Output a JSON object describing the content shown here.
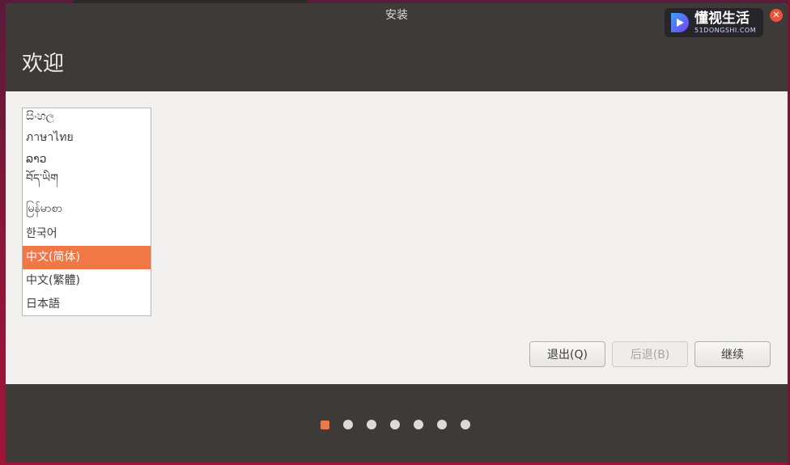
{
  "window": {
    "title": "安装",
    "page_title": "欢迎"
  },
  "watermark": {
    "main": "懂视生活",
    "sub": "51DONGSHI.COM"
  },
  "languages": {
    "items": [
      {
        "label": "සිංහල",
        "selected": false
      },
      {
        "label": "ภาษาไทย",
        "selected": false
      },
      {
        "label": "ລາວ",
        "selected": false
      },
      {
        "label": "བོད་ཡིག",
        "selected": false
      },
      {
        "label": "မြန်မာစာ",
        "selected": false
      },
      {
        "label": "한국어",
        "selected": false
      },
      {
        "label": "中文(简体)",
        "selected": true
      },
      {
        "label": "中文(繁體)",
        "selected": false
      },
      {
        "label": "日本語",
        "selected": false
      }
    ]
  },
  "buttons": {
    "quit": "退出(Q)",
    "back": "后退(B)",
    "continue": "继续"
  },
  "progress": {
    "steps": 7,
    "current": 1
  },
  "colors": {
    "accent": "#f07746",
    "header": "#3d3a38",
    "background": "#f2f1f0"
  }
}
